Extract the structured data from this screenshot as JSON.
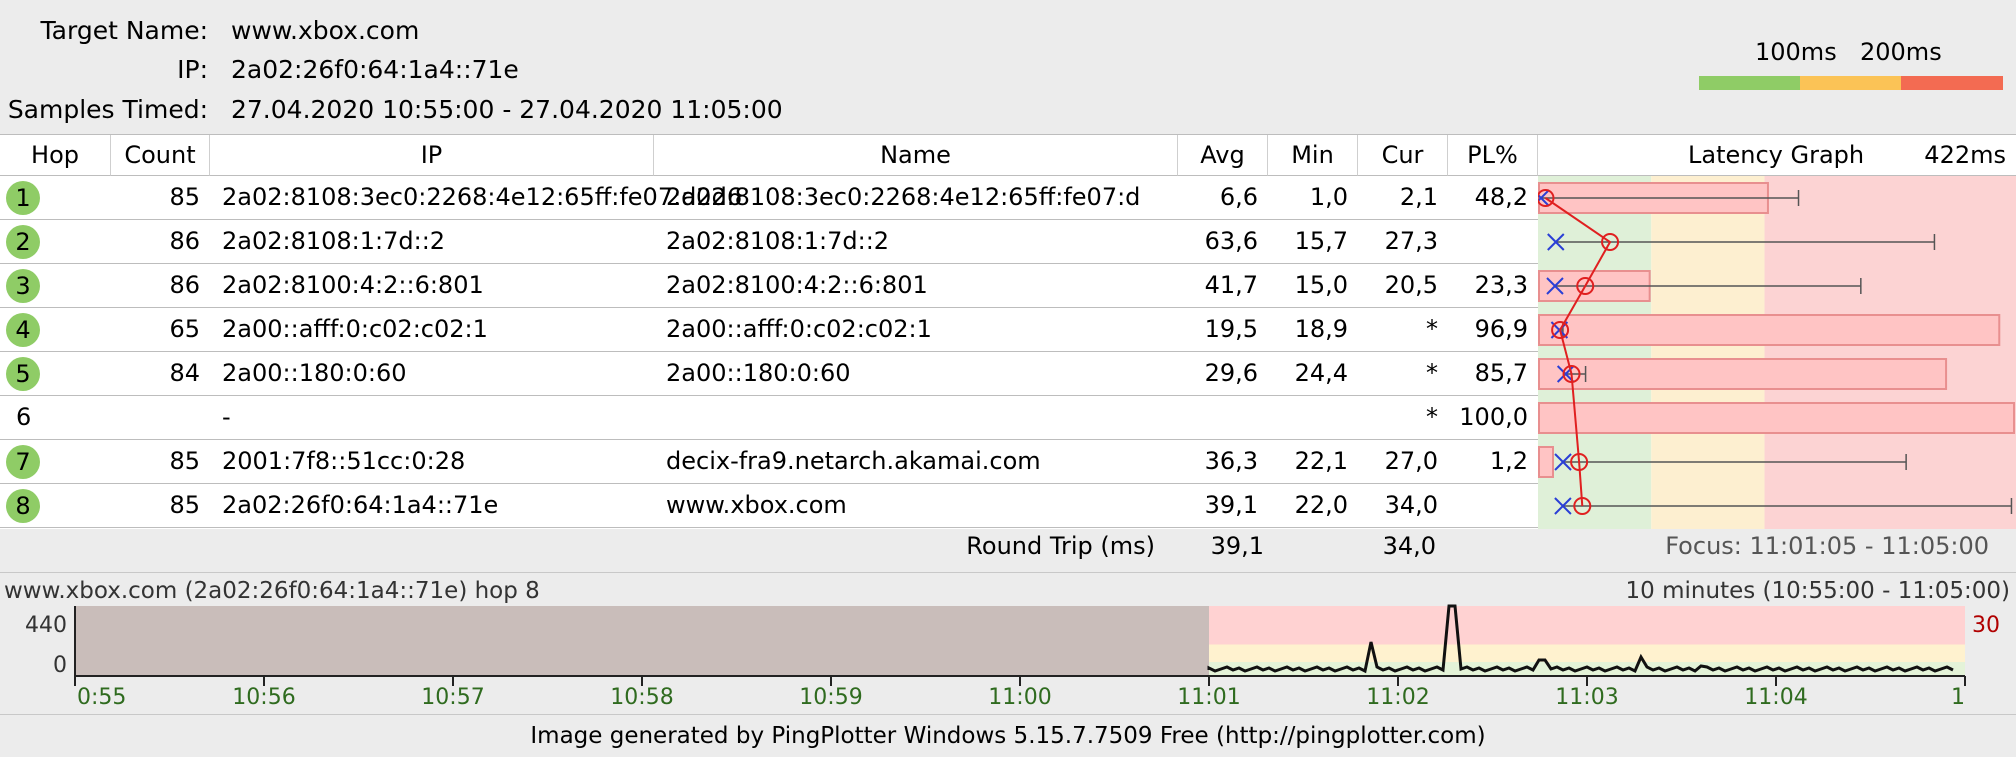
{
  "header": {
    "target_label": "Target Name:",
    "target_value": "www.xbox.com",
    "ip_label": "IP:",
    "ip_value": "2a02:26f0:64:1a4::71e",
    "samples_label": "Samples Timed:",
    "samples_value": "27.04.2020 10:55:00 - 27.04.2020 11:05:00"
  },
  "latency_scale": {
    "label_100": "100ms",
    "label_200": "200ms",
    "colors": [
      "#8fcc66",
      "#fbc356",
      "#f36b52"
    ]
  },
  "table": {
    "columns": [
      "Hop",
      "Count",
      "IP",
      "Name",
      "Avg",
      "Min",
      "Cur",
      "PL%",
      "Latency Graph"
    ],
    "graph_max_label": "422ms",
    "graph_max_ms": 422,
    "rows": [
      {
        "hop": "1",
        "count": "85",
        "ip": "2a02:8108:3ec0:2268:4e12:65ff:fe07:d2d6",
        "name": "2a02:8108:3ec0:2268:4e12:65ff:fe07:d",
        "avg": "6,6",
        "min": "1,0",
        "cur": "2,1",
        "pl": "48,2",
        "active": true,
        "avg_ms": 6.6,
        "min_ms": 1.0,
        "max_ms": 230,
        "pl_pct": 48.2
      },
      {
        "hop": "2",
        "count": "86",
        "ip": "2a02:8108:1:7d::2",
        "name": "2a02:8108:1:7d::2",
        "avg": "63,6",
        "min": "15,7",
        "cur": "27,3",
        "pl": "",
        "active": true,
        "avg_ms": 63.6,
        "min_ms": 15.7,
        "max_ms": 350,
        "pl_pct": 0
      },
      {
        "hop": "3",
        "count": "86",
        "ip": "2a02:8100:4:2::6:801",
        "name": "2a02:8100:4:2::6:801",
        "avg": "41,7",
        "min": "15,0",
        "cur": "20,5",
        "pl": "23,3",
        "active": true,
        "avg_ms": 41.7,
        "min_ms": 15.0,
        "max_ms": 285,
        "pl_pct": 23.3
      },
      {
        "hop": "4",
        "count": "65",
        "ip": "2a00::afff:0:c02:c02:1",
        "name": "2a00::afff:0:c02:c02:1",
        "avg": "19,5",
        "min": "18,9",
        "cur": "*",
        "pl": "96,9",
        "active": true,
        "avg_ms": 19.5,
        "min_ms": 18.9,
        "max_ms": 22,
        "pl_pct": 96.9
      },
      {
        "hop": "5",
        "count": "84",
        "ip": "2a00::180:0:60",
        "name": "2a00::180:0:60",
        "avg": "29,6",
        "min": "24,4",
        "cur": "*",
        "pl": "85,7",
        "active": true,
        "avg_ms": 29.6,
        "min_ms": 24.4,
        "max_ms": 42,
        "pl_pct": 85.7
      },
      {
        "hop": "6",
        "count": "",
        "ip": "-",
        "name": "",
        "avg": "",
        "min": "",
        "cur": "*",
        "pl": "100,0",
        "active": false,
        "pl_pct": 100
      },
      {
        "hop": "7",
        "count": "85",
        "ip": "2001:7f8::51cc:0:28",
        "name": "decix-fra9.netarch.akamai.com",
        "avg": "36,3",
        "min": "22,1",
        "cur": "27,0",
        "pl": "1,2",
        "active": true,
        "avg_ms": 36.3,
        "min_ms": 22.1,
        "max_ms": 325,
        "pl_pct": 1.2
      },
      {
        "hop": "8",
        "count": "85",
        "ip": "2a02:26f0:64:1a4::71e",
        "name": "www.xbox.com",
        "avg": "39,1",
        "min": "22,0",
        "cur": "34,0",
        "pl": "",
        "active": true,
        "avg_ms": 39.1,
        "min_ms": 22.0,
        "max_ms": 418,
        "pl_pct": 0
      }
    ]
  },
  "round_trip": {
    "label": "Round Trip (ms)",
    "avg": "39,1",
    "cur": "34,0",
    "focus": "Focus: 11:01:05 - 11:05:00"
  },
  "timegraph": {
    "title": "www.xbox.com (2a02:26f0:64:1a4::71e) hop 8",
    "range": "10 minutes (10:55:00 - 11:05:00)",
    "y_top_label": "440",
    "y_bottom_label": "0",
    "right_label": "30",
    "x_labels": [
      "0:55",
      "10:56",
      "10:57",
      "10:58",
      "10:59",
      "11:00",
      "11:01",
      "11:02",
      "11:03",
      "11:04",
      "1"
    ],
    "focus_start_fraction": 0.6
  },
  "footer": "Image generated by PingPlotter Windows 5.15.7.7509 Free (http://pingplotter.com)"
}
